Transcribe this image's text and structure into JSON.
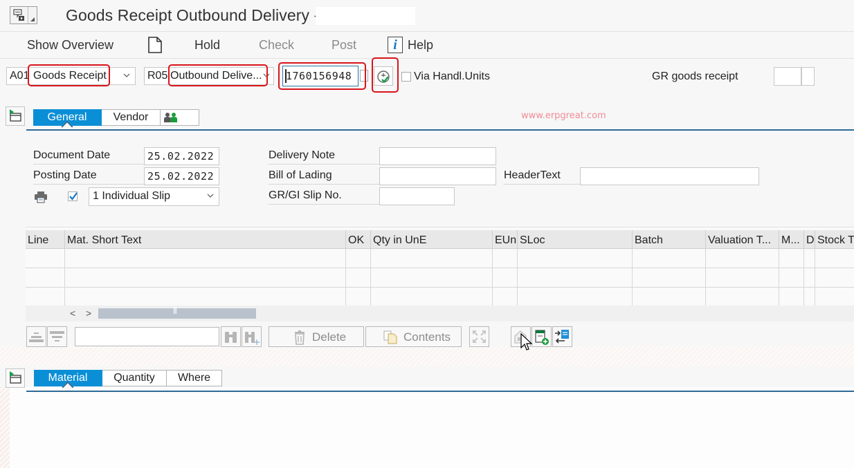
{
  "window": {
    "title": "Goods Receipt Outbound Delivery -",
    "title_suffix_redacted": ""
  },
  "toolbar": {
    "show_overview": "Show Overview",
    "hold": "Hold",
    "check": "Check",
    "post": "Post",
    "help": "Help"
  },
  "selection": {
    "action": {
      "key": "A01",
      "value": "Goods Receipt"
    },
    "reference": {
      "key": "R05",
      "value": "Outbound Delive..."
    },
    "document_number": "1760156948",
    "via_handling_units_label": "Via Handl.Units",
    "via_handling_units_checked": false,
    "movement_type_label": "GR goods receipt",
    "movement_type_value": ""
  },
  "watermark": "www.erpgreat.com",
  "header_tabs": {
    "tabs": [
      {
        "label": "General",
        "active": true
      },
      {
        "label": "Vendor",
        "active": false
      },
      {
        "label": "",
        "icon": "partner-icon",
        "active": false
      }
    ]
  },
  "general": {
    "document_date_label": "Document Date",
    "document_date": "25.02.2022",
    "posting_date_label": "Posting Date",
    "posting_date": "25.02.2022",
    "print_checked": true,
    "slip_option": "1 Individual Slip",
    "delivery_note_label": "Delivery Note",
    "delivery_note": "",
    "bill_of_lading_label": "Bill of Lading",
    "bill_of_lading": "",
    "gr_gi_slip_label": "GR/GI Slip No.",
    "gr_gi_slip": "",
    "header_text_label": "HeaderText",
    "header_text": ""
  },
  "items_table": {
    "columns": [
      "Line",
      "Mat. Short Text",
      "OK",
      "Qty in UnE",
      "EUn",
      "SLoc",
      "Batch",
      "Valuation T...",
      "M...",
      "D",
      "Stock T"
    ],
    "rows": [
      [
        "",
        "",
        "",
        "",
        "",
        "",
        "",
        "",
        "",
        "",
        ""
      ],
      [
        "",
        "",
        "",
        "",
        "",
        "",
        "",
        "",
        "",
        "",
        ""
      ],
      [
        "",
        "",
        "",
        "",
        "",
        "",
        "",
        "",
        "",
        "",
        ""
      ]
    ],
    "scroll_left": "<",
    "scroll_right": ">"
  },
  "items_toolbar": {
    "search_value": "",
    "delete": "Delete",
    "contents": "Contents"
  },
  "detail_tabs": {
    "tabs": [
      {
        "label": "Material",
        "active": true
      },
      {
        "label": "Quantity",
        "active": false
      },
      {
        "label": "Where",
        "active": false
      }
    ]
  }
}
